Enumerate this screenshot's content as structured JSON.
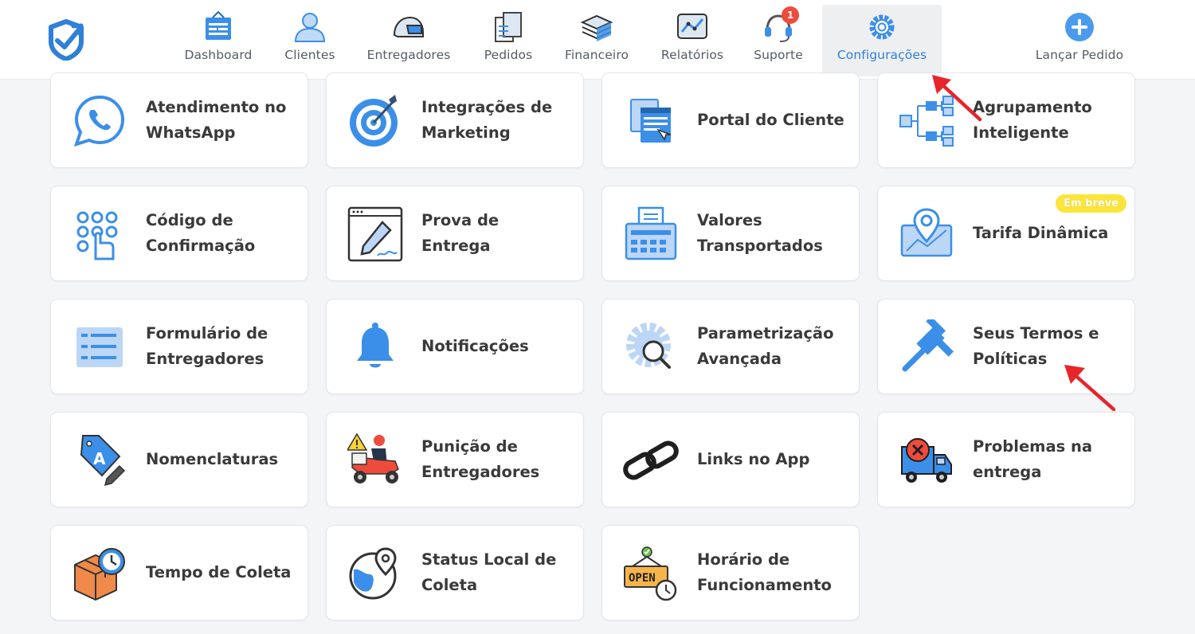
{
  "colors": {
    "accent": "#2f80d8",
    "icon_blue": "#3b8fe8",
    "badge_red": "#ef4b3c",
    "soon_yellow": "#fde43a",
    "arrow_red": "#e8242b"
  },
  "nav": {
    "items": [
      {
        "label": "Dashboard",
        "icon": "dashboard-icon"
      },
      {
        "label": "Clientes",
        "icon": "user-icon"
      },
      {
        "label": "Entregadores",
        "icon": "helmet-icon"
      },
      {
        "label": "Pedidos",
        "icon": "receipt-icon"
      },
      {
        "label": "Financeiro",
        "icon": "money-stack-icon"
      },
      {
        "label": "Relatórios",
        "icon": "chart-icon"
      },
      {
        "label": "Suporte",
        "icon": "headset-icon",
        "badge": "1"
      },
      {
        "label": "Configurações",
        "icon": "gear-icon",
        "active": true
      },
      {
        "label": "Lançar Pedido",
        "icon": "plus-circle-icon"
      }
    ]
  },
  "cards": [
    {
      "label": "Atendimento no WhatsApp",
      "icon": "whatsapp-icon"
    },
    {
      "label": "Integrações de Marketing",
      "icon": "target-icon"
    },
    {
      "label": "Portal do Cliente",
      "icon": "browser-windows-icon"
    },
    {
      "label": "Agrupamento Inteligente",
      "icon": "hierarchy-icon"
    },
    {
      "label": "Código de Confirmação",
      "icon": "keypad-icon"
    },
    {
      "label": "Prova de Entrega",
      "icon": "signature-pen-icon"
    },
    {
      "label": "Valores Transportados",
      "icon": "cash-register-icon"
    },
    {
      "label": "Tarifa Dinâmica",
      "icon": "map-pin-icon",
      "badge": "Em breve"
    },
    {
      "label": "Formulário de Entregadores",
      "icon": "form-list-icon"
    },
    {
      "label": "Notificações",
      "icon": "bell-icon"
    },
    {
      "label": "Parametrização Avançada",
      "icon": "gear-search-icon"
    },
    {
      "label": "Seus Termos e Políticas",
      "icon": "gavel-icon"
    },
    {
      "label": "Nomenclaturas",
      "icon": "tag-icon"
    },
    {
      "label": "Punição de Entregadores",
      "icon": "scooter-warning-icon"
    },
    {
      "label": "Links no App",
      "icon": "link-icon"
    },
    {
      "label": "Problemas na entrega",
      "icon": "truck-cancel-icon"
    },
    {
      "label": "Tempo de Coleta",
      "icon": "box-clock-icon"
    },
    {
      "label": "Status Local de Coleta",
      "icon": "globe-pin-icon"
    },
    {
      "label": "Horário de Funcionamento",
      "icon": "open-sign-icon"
    }
  ]
}
